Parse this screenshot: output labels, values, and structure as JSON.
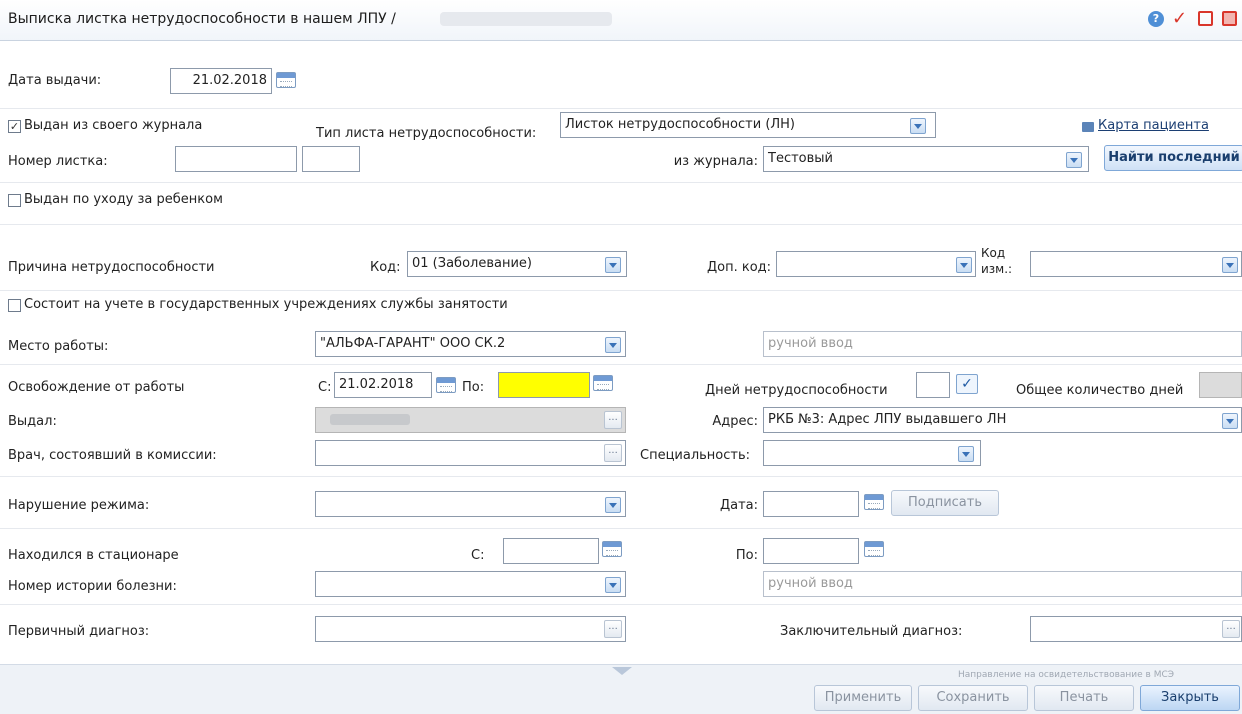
{
  "window": {
    "title": "Выписка листка нетрудоспособности в нашем ЛПУ /",
    "icons": [
      "help-icon",
      "check-icon",
      "minimize-icon",
      "close-icon"
    ]
  },
  "issue_date": {
    "label": "Дата выдачи:",
    "value": "21.02.2018"
  },
  "own_journal": {
    "label": "Выдан из своего журнала",
    "checked": true
  },
  "sheet_type": {
    "label": "Тип листа нетрудоспособности:",
    "value": "Листок нетрудоспособности (ЛН)"
  },
  "patient_card_link": "Карта пациента",
  "sheet_number": {
    "label": "Номер листка:",
    "value1": "",
    "value2": ""
  },
  "journal": {
    "label": "из журнала:",
    "value": "Тестовый"
  },
  "find_last_button": "Найти последний",
  "child_care": {
    "label": "Выдан по уходу за ребенком",
    "checked": false
  },
  "reason": {
    "label": "Причина нетрудоспособности",
    "code_label": "Код:",
    "code_value": "01 (Заболевание)",
    "extra_code_label": "Доп. код:",
    "extra_code_value": "",
    "change_code_label_1": "Код",
    "change_code_label_2": "изм.:",
    "change_code_value": ""
  },
  "employment_service": {
    "label": "Состоит на учете в государственных учреждениях службы занятости",
    "checked": false
  },
  "workplace": {
    "label": "Место работы:",
    "value": "\"АЛЬФА-ГАРАНТ\" ООО СК.2",
    "manual_placeholder": "ручной ввод"
  },
  "release": {
    "label": "Освобождение от работы",
    "from_label": "С:",
    "from_value": "21.02.2018",
    "to_label": "По:",
    "to_value": "",
    "days_label": "Дней нетрудоспособности",
    "days_value": "",
    "total_days_label": "Общее количество дней",
    "total_days_value": ""
  },
  "issued_by": {
    "label": "Выдал:",
    "value": ""
  },
  "address": {
    "label": "Адрес:",
    "value": "РКБ №3: Адрес ЛПУ выдавшего ЛН"
  },
  "commission_doctor": {
    "label": "Врач, состоявший в комиссии:",
    "value": ""
  },
  "specialty": {
    "label": "Специальность:",
    "value": ""
  },
  "violation": {
    "label": "Нарушение режима:",
    "value": "",
    "date_label": "Дата:",
    "date_value": "",
    "sign_button": "Подписать"
  },
  "hospital": {
    "label": "Находился в стационаре",
    "from_label": "С:",
    "from_value": "",
    "to_label": "По:",
    "to_value": ""
  },
  "history_number": {
    "label": "Номер истории болезни:",
    "value": "",
    "manual_placeholder": "ручной ввод"
  },
  "primary_diagnosis": {
    "label": "Первичный диагноз:",
    "value": ""
  },
  "final_diagnosis": {
    "label": "Заключительный диагноз:",
    "value": ""
  },
  "footer": {
    "mse_note": "Направление на освидетельствование в МСЭ",
    "buttons": {
      "apply": "Применить",
      "save": "Сохранить",
      "print": "Печать",
      "close": "Закрыть"
    }
  }
}
